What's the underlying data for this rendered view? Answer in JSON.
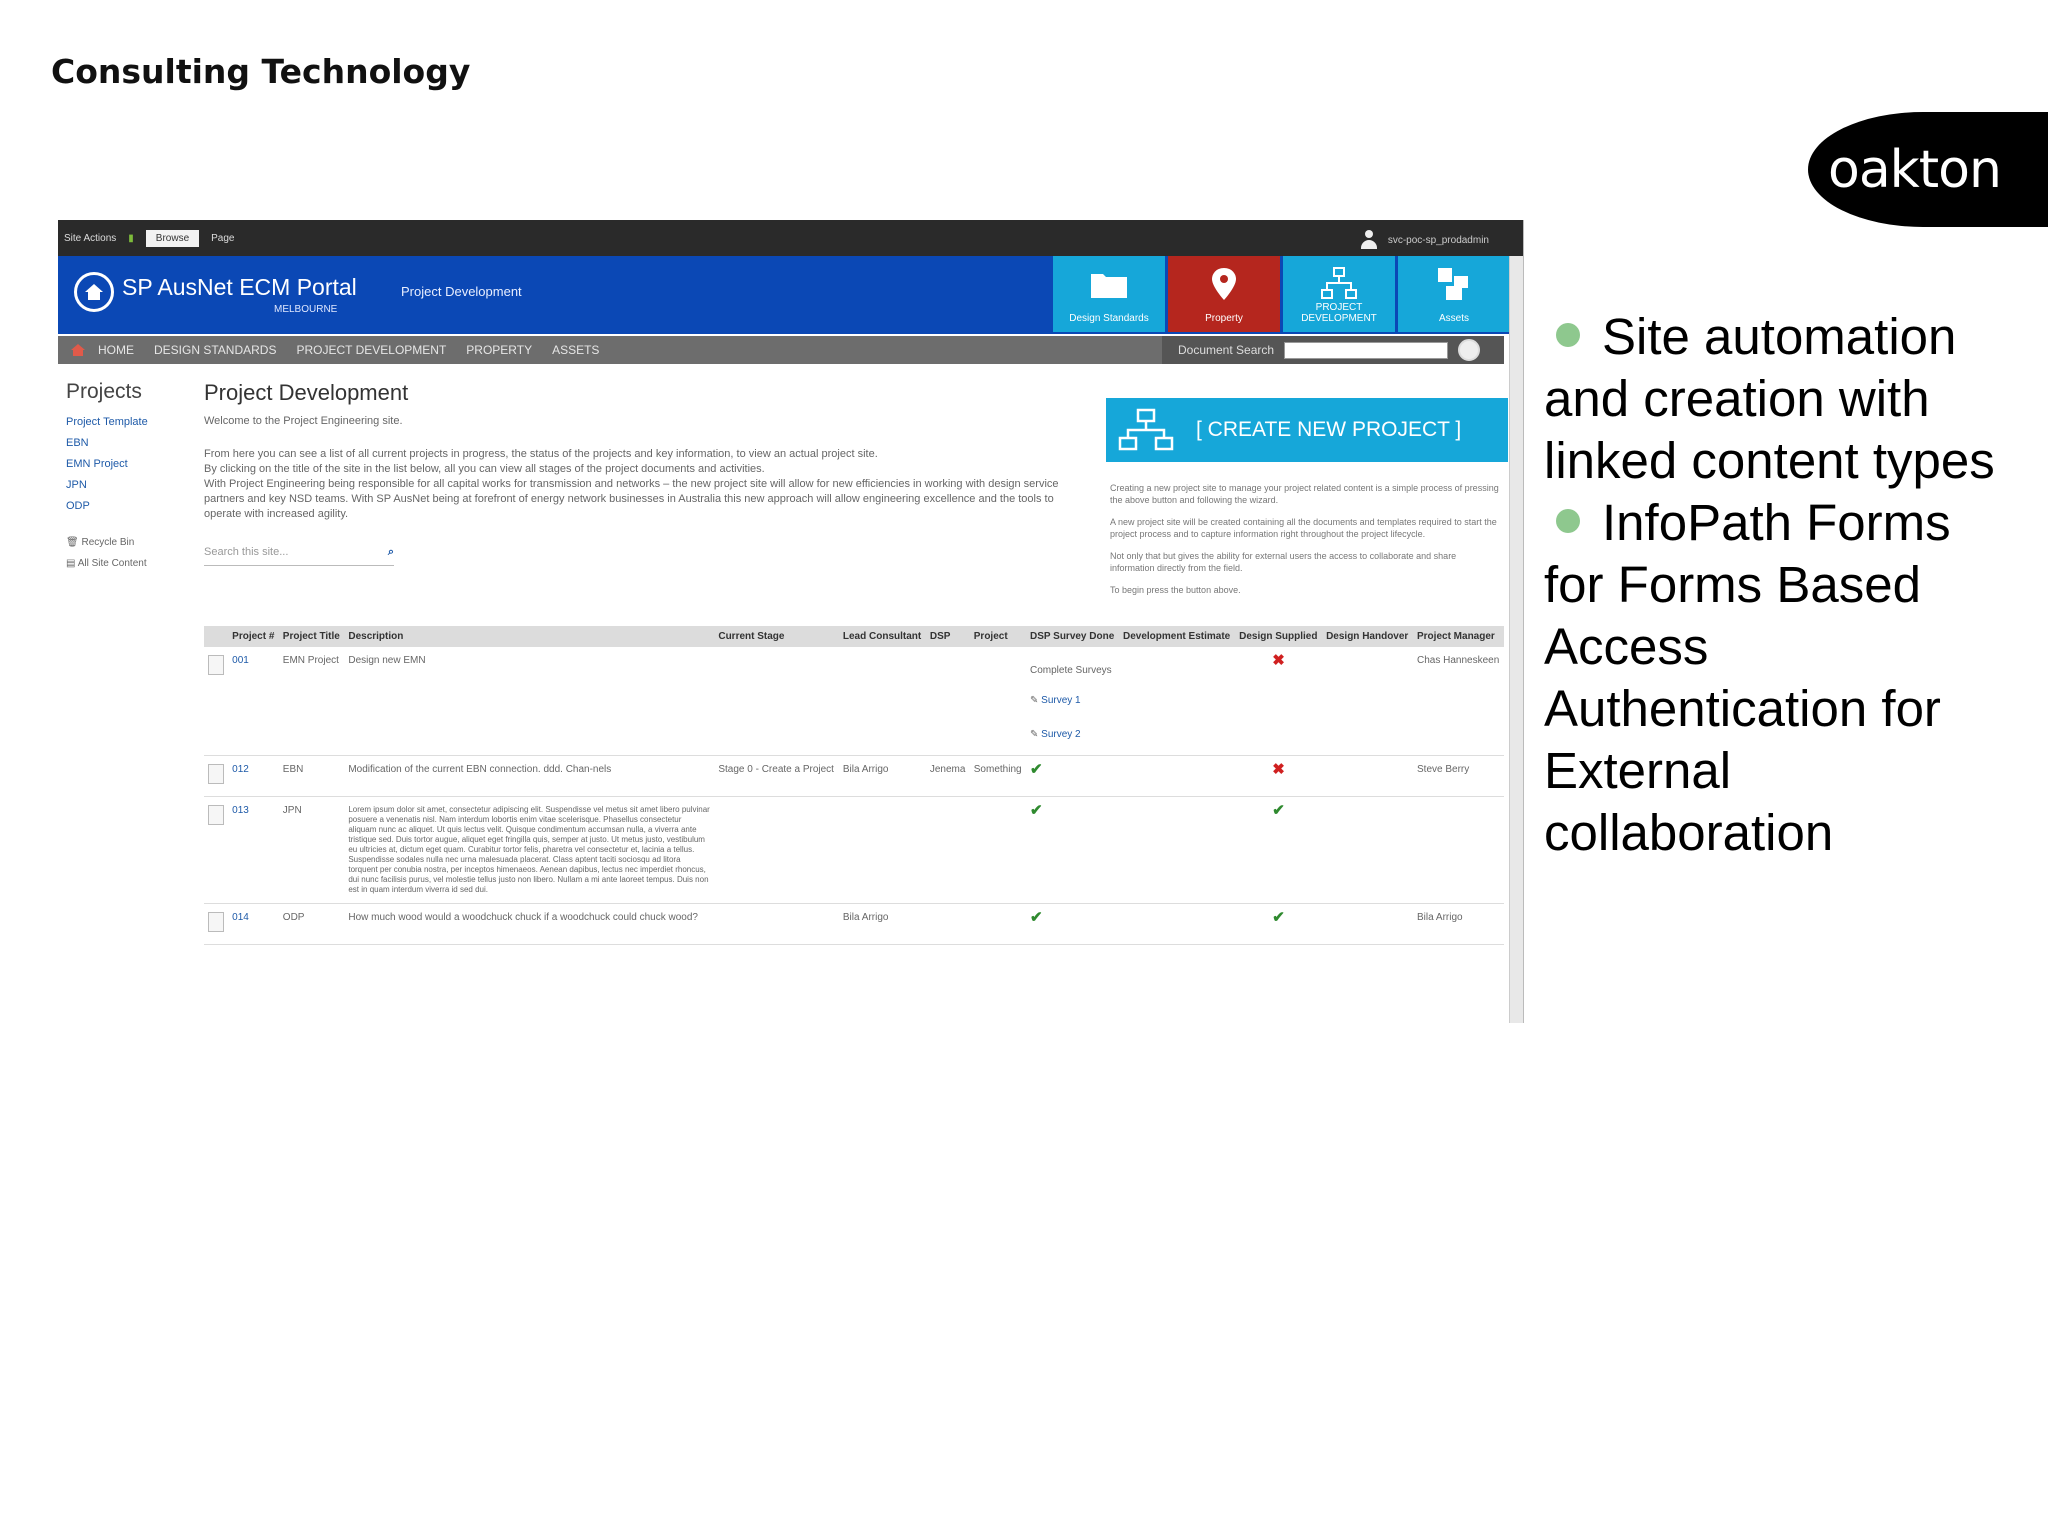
{
  "slide": {
    "title": "Consulting Technology",
    "logo_text": "oakton",
    "bullets": [
      "Site automation and creation with linked content types",
      "InfoPath Forms for  Forms Based Access Authentication for External collaboration"
    ],
    "bullet_color": "#8ec88e"
  },
  "sharepoint": {
    "ribbon": {
      "site_actions": "Site Actions",
      "tab_browse": "Browse",
      "tab_page": "Page",
      "user": "svc-poc-sp_prodadmin"
    },
    "banner": {
      "portal_title": "SP AusNet ECM Portal",
      "portal_subtitle": "MELBOURNE",
      "section": "Project Development",
      "tiles": [
        "Design Standards",
        "Property",
        "PROJECT DEVELOPMENT",
        "Assets"
      ]
    },
    "nav": {
      "items": [
        "HOME",
        "DESIGN STANDARDS",
        "PROJECT DEVELOPMENT",
        "PROPERTY",
        "ASSETS"
      ],
      "search_label": "Document Search"
    },
    "left_nav": {
      "heading": "Projects",
      "items": [
        "Project Template",
        "EBN",
        "EMN Project",
        "JPN",
        "ODP"
      ],
      "recycle_bin": "Recycle Bin",
      "all_site_content": "All Site Content"
    },
    "main": {
      "heading": "Project Development",
      "welcome": "Welcome to the Project Engineering site.",
      "para1": "From here you can see a list of all current projects in progress, the status of the projects and key information, to view an actual project site.",
      "para2": "By clicking on the title of the site in the list below, all you can view all stages of the project documents and activities.",
      "para3": "With Project Engineering being responsible for all capital works for transmission and networks – the new project site will allow for new efficiencies in working with design service partners and key NSD teams. With SP AusNet being at forefront of energy network businesses in Australia this new approach will allow engineering excellence and the tools to operate with increased agility.",
      "search_placeholder": "Search this site..."
    },
    "create": {
      "label": "[ CREATE NEW PROJECT ]",
      "note1": "Creating a new project site to manage your project related content is a simple process of pressing the above button and following the wizard.",
      "note2": "A new project site will be created containing all the documents and templates required to start the project process and to capture information right throughout the project lifecycle.",
      "note3": "Not only that but gives the ability for external users the access to collaborate and share information directly from the field.",
      "note4": "To begin press the button above."
    },
    "table": {
      "headers": [
        "Project #",
        "Project Title",
        "Description",
        "Current Stage",
        "Lead Consultant",
        "DSP",
        "Project",
        "DSP Survey Done",
        "Development Estimate",
        "Design Supplied",
        "Design Handover",
        "Project Manager"
      ],
      "rows": [
        {
          "id": "001",
          "title": "EMN Project",
          "desc": "Design new EMN",
          "stage": "",
          "lead": "",
          "dsp": "",
          "project": "",
          "survey_header": "Complete Surveys",
          "survey1": "Survey 1",
          "survey2": "Survey 2",
          "dev": "",
          "supplied": "✖",
          "handover": "",
          "pm": "Chas Hanneskeen"
        },
        {
          "id": "012",
          "title": "EBN",
          "desc": "Modification of the current EBN connection. ddd. Chan-nels",
          "stage": "Stage 0 - Create a Project",
          "lead": "Bila Arrigo",
          "dsp": "Jenema",
          "project": "Something",
          "survey_mark": "✔",
          "dev": "",
          "supplied": "✖",
          "handover": "",
          "pm": "Steve Berry"
        },
        {
          "id": "013",
          "title": "JPN",
          "desc": "Lorem ipsum dolor sit amet, consectetur adipiscing elit. Suspendisse vel metus sit amet libero pulvinar posuere a venenatis nisl. Nam interdum lobortis enim vitae scelerisque. Phasellus consectetur aliquam nunc ac aliquet. Ut quis lectus velit. Quisque condimentum accumsan nulla, a viverra ante tristique sed. Duis tortor augue, aliquet eget fringilla quis, semper at justo. Ut metus justo, vestibulum eu ultricies at, dictum eget quam. Curabitur tortor felis, pharetra vel consectetur et, lacinia a tellus. Suspendisse sodales nulla nec urna malesuada placerat. Class aptent taciti sociosqu ad litora torquent per conubia nostra, per inceptos himenaeos. Aenean dapibus, lectus nec imperdiet rhoncus, dui nunc facilisis purus, vel molestie tellus justo non libero. Nullam a mi ante laoreet tempus. Duis non est in quam interdum viverra id sed dui.",
          "stage": "",
          "lead": "",
          "dsp": "",
          "project": "",
          "survey_mark": "✔",
          "dev": "",
          "supplied": "✔",
          "handover": "",
          "pm": ""
        },
        {
          "id": "014",
          "title": "ODP",
          "desc": "How much wood would a woodchuck chuck if a woodchuck could chuck wood?",
          "stage": "",
          "lead": "Bila Arrigo",
          "dsp": "",
          "project": "",
          "survey_mark": "✔",
          "dev": "",
          "supplied": "✔",
          "handover": "",
          "pm": "Bila Arrigo"
        }
      ]
    }
  }
}
